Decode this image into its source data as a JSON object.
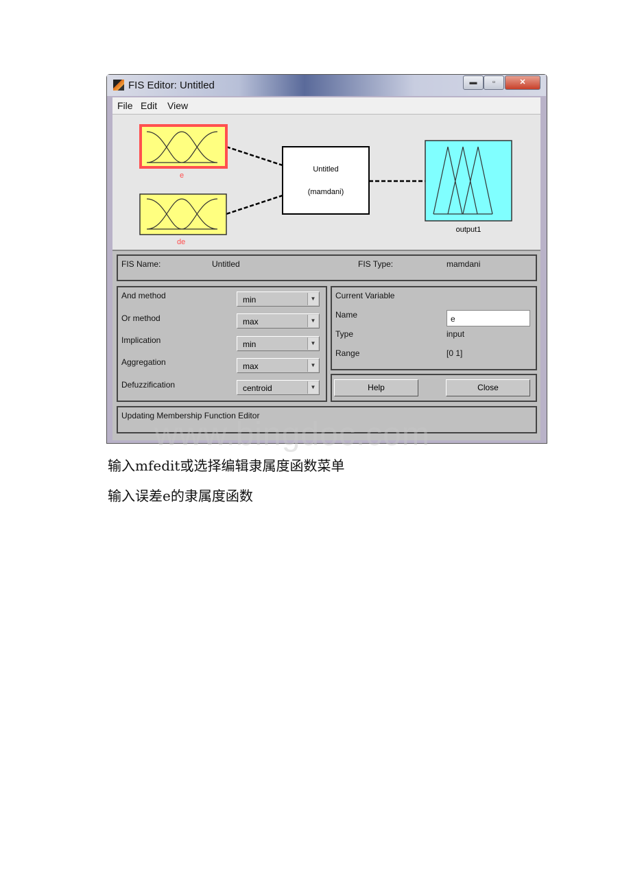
{
  "window": {
    "title": "FIS Editor: Untitled",
    "controls": [
      "minimize",
      "maximize",
      "close"
    ]
  },
  "menu": [
    "File",
    "Edit",
    "View"
  ],
  "diagram": {
    "inputs": [
      {
        "name": "e",
        "selected": true
      },
      {
        "name": "de",
        "selected": false
      }
    ],
    "system": {
      "name": "Untitled",
      "type": "(mamdani)"
    },
    "output": {
      "name": "output1"
    },
    "colors": {
      "input_fill": "#ffff80",
      "selected_border": "#ff5050",
      "output_fill": "#80ffff",
      "label_input": "#ff5050"
    }
  },
  "fis": {
    "name_label": "FIS Name:",
    "name_value": "Untitled",
    "type_label": "FIS Type:",
    "type_value": "mamdani"
  },
  "methods": [
    {
      "label": "And method",
      "value": "min"
    },
    {
      "label": "Or method",
      "value": "max"
    },
    {
      "label": "Implication",
      "value": "min"
    },
    {
      "label": "Aggregation",
      "value": "max"
    },
    {
      "label": "Defuzzification",
      "value": "centroid"
    }
  ],
  "current_variable": {
    "title": "Current Variable",
    "name_label": "Name",
    "name_value": "e",
    "type_label": "Type",
    "type_value": "input",
    "range_label": "Range",
    "range_value": "[0 1]"
  },
  "buttons": {
    "help": "Help",
    "close": "Close"
  },
  "status": "Updating Membership Function Editor",
  "watermark": "www.bingdoc.com",
  "doc_lines": [
    "输入mfedit或选择编辑隶属度函数菜单",
    "输入误差e的隶属度函数"
  ]
}
